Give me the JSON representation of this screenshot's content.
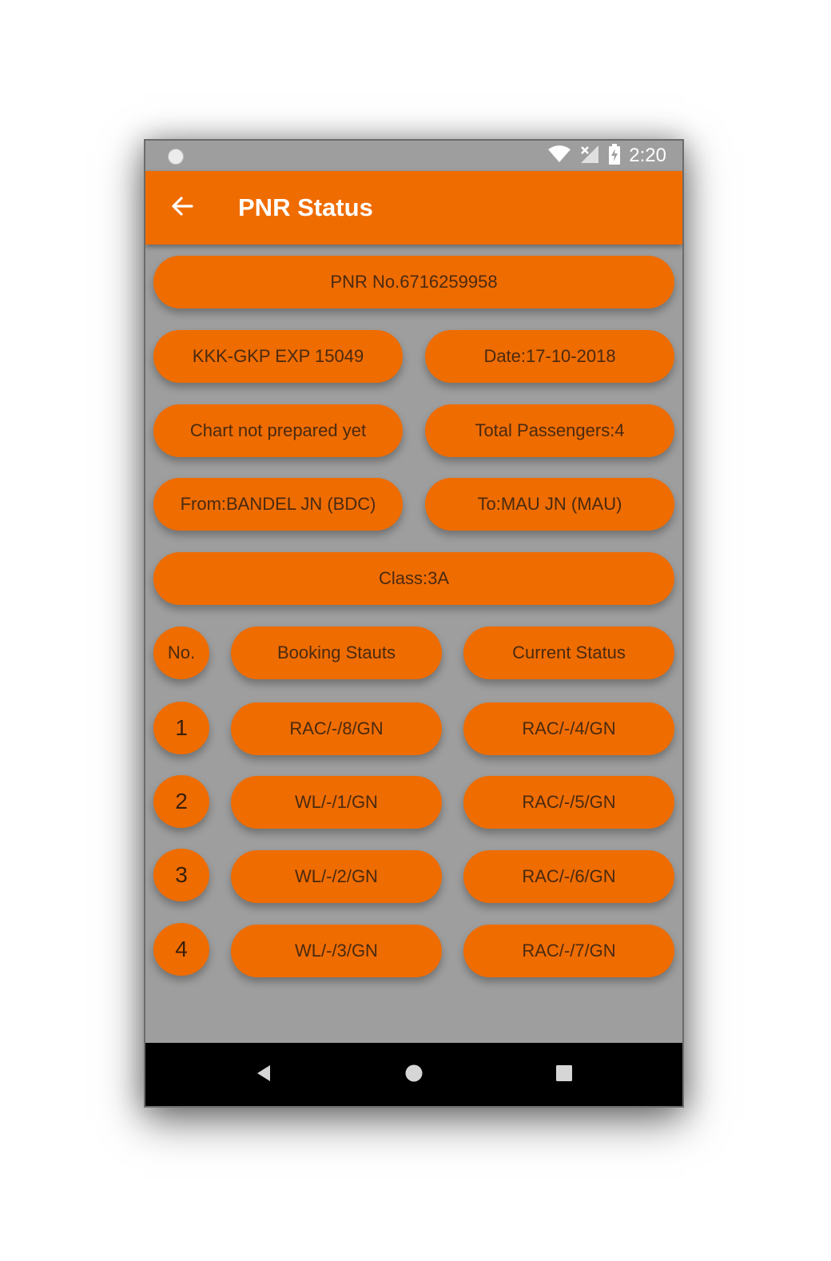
{
  "status_bar": {
    "time": "2:20"
  },
  "app_bar": {
    "title": "PNR Status"
  },
  "info": {
    "pnr": "PNR No.6716259958",
    "train": "KKK-GKP EXP 15049",
    "date": "Date:17-10-2018",
    "chart": "Chart not prepared yet",
    "passengers": "Total Passengers:4",
    "from": "From:BANDEL JN (BDC)",
    "to": "To:MAU JN (MAU)",
    "class": "Class:3A"
  },
  "table": {
    "headers": {
      "no": "No.",
      "booking": "Booking Stauts",
      "current": "Current Status"
    },
    "rows": [
      {
        "no": "1",
        "booking": "RAC/-/8/GN",
        "current": "RAC/-/4/GN"
      },
      {
        "no": "2",
        "booking": "WL/-/1/GN",
        "current": "RAC/-/5/GN"
      },
      {
        "no": "3",
        "booking": "WL/-/2/GN",
        "current": "RAC/-/6/GN"
      },
      {
        "no": "4",
        "booking": "WL/-/3/GN",
        "current": "RAC/-/7/GN"
      }
    ]
  },
  "colors": {
    "accent": "#ef6c00",
    "background": "#9e9e9e",
    "navbar": "#000000"
  }
}
